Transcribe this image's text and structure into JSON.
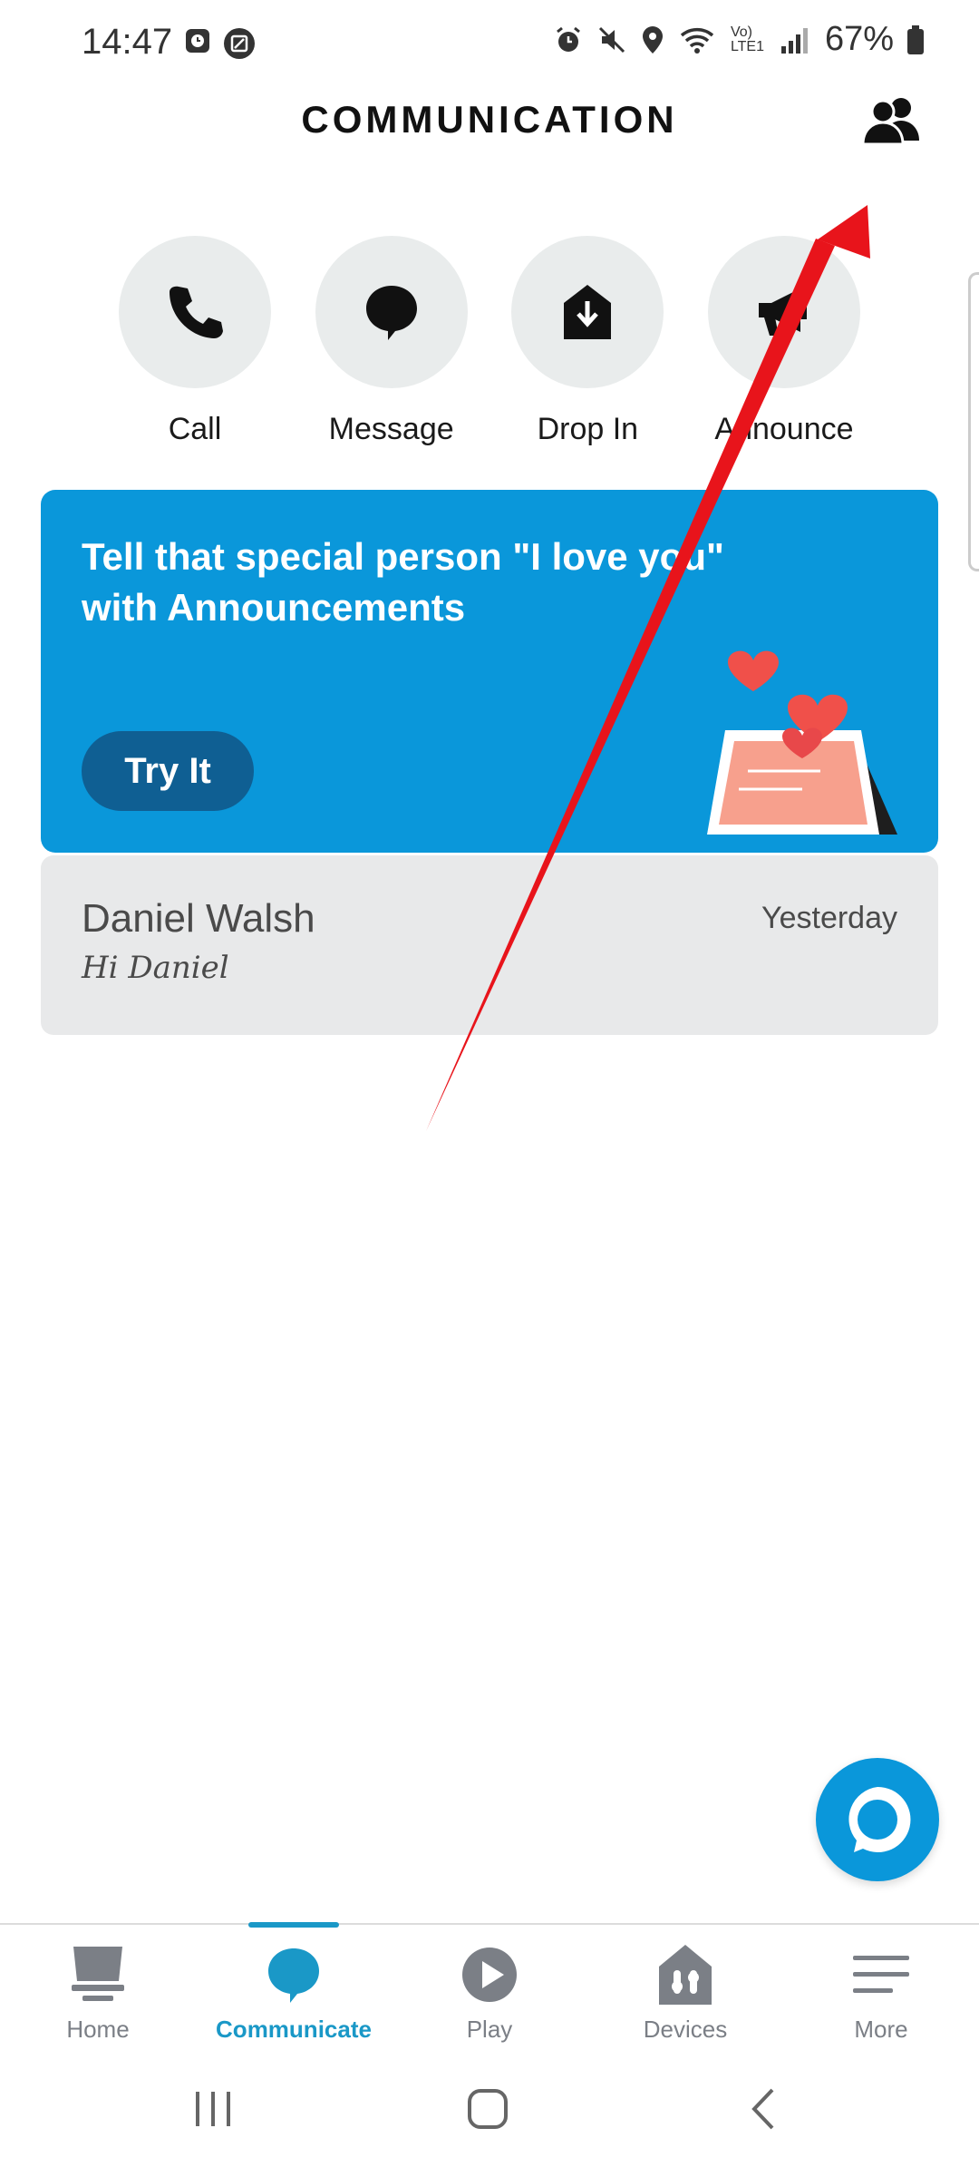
{
  "status_bar": {
    "time": "14:47",
    "battery": "67%",
    "network": "Vo) LTE1"
  },
  "header": {
    "title": "COMMUNICATION",
    "contacts_icon": "contacts-icon"
  },
  "actions": [
    {
      "label": "Call",
      "icon": "phone-icon"
    },
    {
      "label": "Message",
      "icon": "chat-bubble-icon"
    },
    {
      "label": "Drop In",
      "icon": "drop-in-icon"
    },
    {
      "label": "Announce",
      "icon": "megaphone-icon"
    }
  ],
  "promo": {
    "text": "Tell that special person \"I love you\" with Announcements",
    "button_label": "Try It"
  },
  "messages": [
    {
      "name": "Daniel Walsh",
      "date": "Yesterday",
      "preview": "Hi Daniel"
    }
  ],
  "bottom_nav": [
    {
      "label": "Home",
      "icon": "home-icon",
      "active": false
    },
    {
      "label": "Communicate",
      "icon": "communicate-icon",
      "active": true
    },
    {
      "label": "Play",
      "icon": "play-icon",
      "active": false
    },
    {
      "label": "Devices",
      "icon": "devices-icon",
      "active": false
    },
    {
      "label": "More",
      "icon": "menu-icon",
      "active": false
    }
  ],
  "colors": {
    "accent": "#0a97da",
    "active_nav": "#1a98c7",
    "promo_button": "#0f5f93",
    "annotation_arrow": "#e8141b"
  }
}
